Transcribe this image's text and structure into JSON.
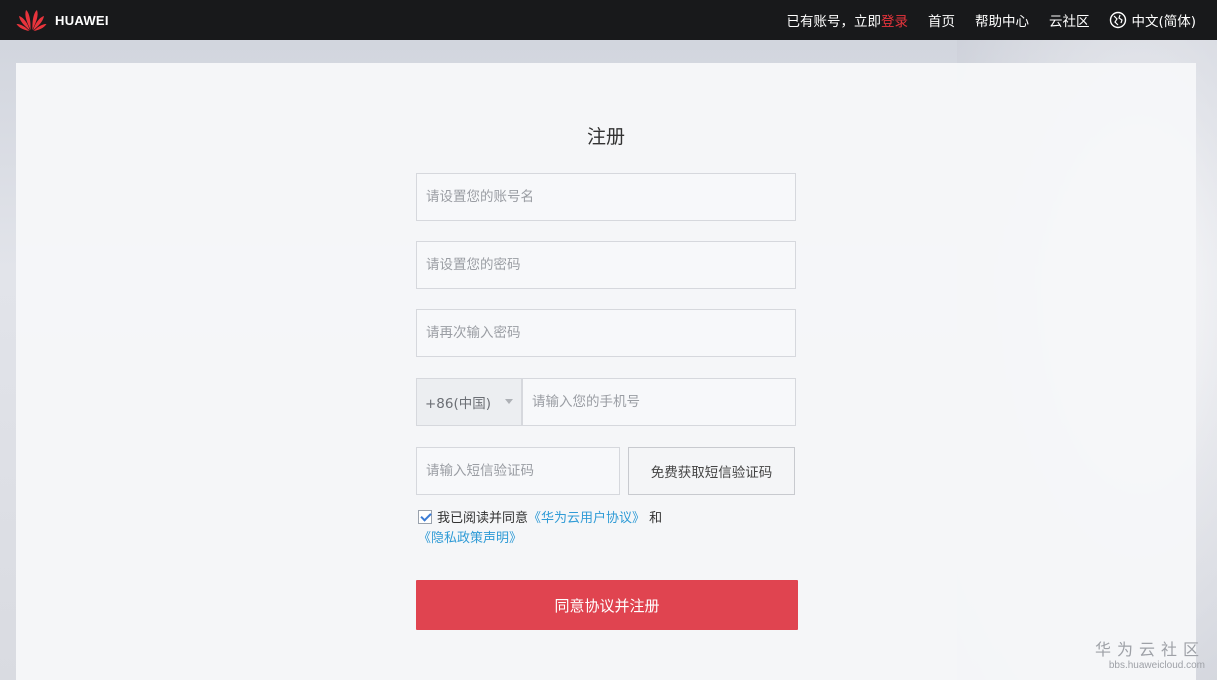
{
  "brand": {
    "name": "HUAWEI",
    "accent": "#e8343c"
  },
  "nav": {
    "login_prompt": "已有账号，立即",
    "login_link": "登录",
    "items": [
      "首页",
      "帮助中心",
      "云社区"
    ],
    "language": "中文(简体)"
  },
  "form": {
    "title": "注册",
    "account_placeholder": "请设置您的账号名",
    "password_placeholder": "请设置您的密码",
    "confirm_placeholder": "请再次输入密码",
    "country_code": "+86(中国)",
    "phone_placeholder": "请输入您的手机号",
    "sms_placeholder": "请输入短信验证码",
    "sms_button": "免费获取短信验证码",
    "agree_prefix": "我已阅读并同意",
    "agreement_link": "《华为云用户协议》",
    "agree_and": "和",
    "privacy_link": "《隐私政策声明》",
    "agree_checked": true,
    "submit": "同意协议并注册"
  },
  "watermark": {
    "title": "华为云社区",
    "url": "bbs.huaweicloud.com"
  },
  "colors": {
    "submit": "#e04450",
    "link": "#2f9bd6",
    "topbar": "#18191b"
  }
}
